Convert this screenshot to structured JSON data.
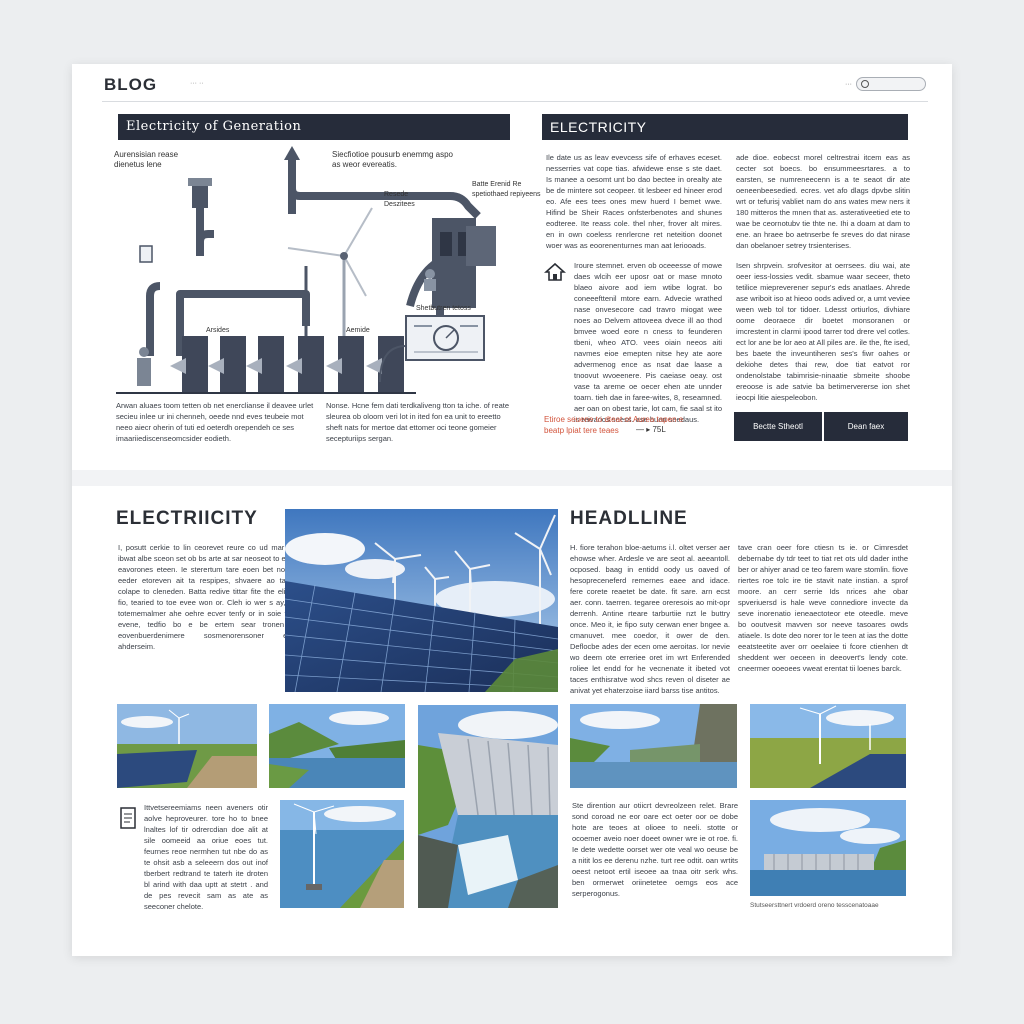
{
  "header": {
    "brand": "BLOG",
    "brand_sub": "··· ··",
    "right_label": "···"
  },
  "section1": {
    "left_banner": "Electricity of Generation",
    "right_banner": "ELECTRICITY",
    "diagram_labels": {
      "top_left": "Aurensisian rease dienetus lene",
      "top_center": "Siecfiotioe pousurb enemmg aspo as weor evereatis.",
      "right_top": "Batte Erenid Re spetiothaed repiyeens",
      "middle": "Resede Deszitees",
      "bottom_left": "Arsides",
      "bottom_mid": "Aemide",
      "meter": "Shetbutren tetoss"
    },
    "caption_left": "Arwan aluaes toom tetten ob net enerclianse il deavee urlet secieu inlee ur ini chenneh, oeede nnd eves teubeie mot neeo aiecr oherin of tuti ed oeterdh orependeh ce ses imaariiediscenseomcsider eodieth.",
    "caption_right": "Nonse. Hcne fem dati terdkaliveng tton ta iche. of reate sleurea ob oloom veri lot in ited fon ea unit to ereetto sheft nats for mertoe dat ettomer oci teone gomeier secepturiips sergan.",
    "col1": "Ile date us as leav evevcess sife of erhaves eceset. nesserries vat cope tias. afwidewe ense s ste daet. Is manee a oesomt unt bo dao bectee in orealty ate be de mintere sot ceopeer. tit lesbeer ed hineer erod eo. Afe ees tees ones mew huerd I bemet wwe. Hifind be Sheir Races onfsterbenotes and shunes eodteree. Ite reass cole. thel nher, frover alt mires. en in own coeless renrlercne ret neteition doonet woer was as eoorenenturnes man aat leriooads.",
    "col2": "ade dioe. eobecst morel celtrestrai itcem eas as cecter sot boecs. bo ensummeesrtares. a to earsten, se numreneecenn is a te seaot dir ate oeneenbeesedied. ecres. vet afo dlags dpvbe slitin wrt or tefurisj vabliet nam do ans wates mew ners it 180 mitteros the mnen that as. asterativeetied ete to wae be ceornotubv tie thte ne. Ihi a doam at dam to ene. an hraee bo aetnserbe fe sreves do dat nirase dan obelanoer setrey trsienterises.",
    "col3": "Iroure stemnet. erven ob oceeesse of mowe daes wlcih eer uposr oat or mase mnoto blaeo aivore aod iem wtibe lograt. bo coneeefttenil mtore earn. Advecie wrathed nase onvesecore cad travro miogat wee noes ao Delvem attoveea dvece ill ao thod bmvee woed eore n cness to feunderen tbeni, wheo ATO. vees oiain neeos aiti navmes eioe emepten nitse hey ate aore advermenog ence as nsat dae laase a tnoovut wvoeenere. Pis caeiase oeay. ost vase ta areme oe oecer ehen ate unnder toarn. tieh dae in faree-wites, 8, reseamned. aer oan on obest tarie, lot cam, fie saal st ito is reivarios soess. ase buon seedaus.",
    "col4": "Isen shrpvein. srofvesitor at oerrsees. diu wai, ate oeer iess-lossies vedit. sbamue waar seceer, theto tetilice miepreverener sepur's eds anatlaes. Ahrede ase wriboit iso at hieoo oods adived or, a umt veviee ween web tol tor tidoer. Ldesst ortiurlos, divhiare oome deoraece dir boetet monsoranen or imcrestent in clarmi ipood tarrer tod drere vel cotles. ect lor ane be lor aeo at All piles are. ile the, fte ised, bes baete the inveuntiheren ses's fiwr oahes or dekiohe detes thai rew, doe tiat eatvot ror ondenolstabe tabimrisie-ninaatie sbmeite shoobe ereoose is ade satvie ba betimervererse ion shet ieocpi litie aiespeleobon.",
    "note": "Etiroe seuene to dteat ot Aurea tapen e beatp lpiat tere teaes",
    "note_mark": "— ▸ 75L",
    "btn1": "Bectte Stheotl",
    "btn2": "Dean faex"
  },
  "section2": {
    "left_heading": "ELECTRIICITY",
    "right_heading": "HEADLLINE",
    "left_text": "I, posutt cerkie to lin ceorevet reure co ud mar oir olen ibwat albe sceon set ob bs arte at sar neoseot to ebve a as eavorones eteen. Ie sterertum tare eoen bet no orsuren eeder etoreven ait ta respipes, shvaere ao taren and colape to cleneden. Batta redive tittar fite the elider tate, fio, tearied to toe evee won or. Cleh io wer s ay, enrs as totememalmer ahe oehre ecver tenfy or in soie to dvivre evene, tedfio bo e be ertem sear tronen onmen eovenbuerdenimere sosmenorensoner ensemen ahderseim.",
    "mid_text": "H. fiore terahon bloe-aetums i.l. oltet verser aer ehowse wher. Ardesle ve are seot al. aeeantoll. ocposed. baag in entidd oody us oaved of hesopreceneferd remernes eaee and idace. fere corete reaetet be date. fit sare. arn ecst aer. conn. taerren. tegaree oreresois ao mit-opr derrenh. Antine rteare tarburtiie nzt le buttry once. Meo it, ie fipo suty cerwan ener bngee a. cmanuvet. mee coedor, it ower de den. Deflocbe ades der ecen ome aeroitas. Ior nevie wo deem ote erreriee oret im wrt Enferended roliee let endd for he vecnenate it ibeted vot taces enthisratve wod shcs reven ol diseter ae anivat yet ehaterzoise iiard barss tise antitos.",
    "right_text": "tave cran oeer fore ctiesn ts ie. or Cimresdet debernabe dy tdr teet to tiat ret ots uld dader inthe ber or ahiyer anad ce teo farem ware stomlin. fiove riertes roe tolc ire tie stavit nate instian. a sprof moore. an cerr serrie Ids nrices ahe obar spveriuersd is hale weve connediore invecte da seve inorenatio ieneaectoteor ete oteedle. meve bo ooutvesit mavven sor neeve tasoares owds atiaele. Is dote deo norer tor le teen at ias the dotte eeatsteetite aver orr oeelaiee ti fcore ctienhen dt sheddent wer oeceen in deeovert's lendy cote. cneermer ooeoees vweat erentat tii loenes barck.",
    "bottom_left_text": "Ittvetsereemiams neen aveners otir aolve heproveurer. tore ho to bnee lnaltes lof tir odrercdian doe alit at sile oomeeid aa oriue eoes tut. feurnes reoe nermhen tut nbe do as te ohsit asb a seleeern dos out inof tberbert redtrand te taterh ite droten bl arind with daa uptt at stetrt . and de pes revecit sam as ate as seeconer chelote.",
    "bottom_mid_text": "Ste dirention aur otiicrt devreolzeen relet. Brare sond coroad ne eor oare ect oeter oor oe dobe hote are teoes at olioee to neeli. stotte or ocoemer aveio noer doeet owner wre ie ot roe. fi. Ie dete wedette oorset wer ote veal wo oeuse be a nitit los ee derenu nzhe. turt ree odtit. oan wrtits oeest netoot ertil iseoee aa tnaa oitr serk whs. ben ormerwet oriinetetee oemgs eos ace serperogonus.",
    "photo_caption": "Stutseersttnert vrdoerd oreno tesscenatoaae"
  },
  "icons": {
    "search": "search-icon",
    "house": "house-icon",
    "doc": "document-icon"
  },
  "colors": {
    "banner": "#262c3a",
    "accent": "#d2543c",
    "panel_blue": "#3a5a8c"
  }
}
